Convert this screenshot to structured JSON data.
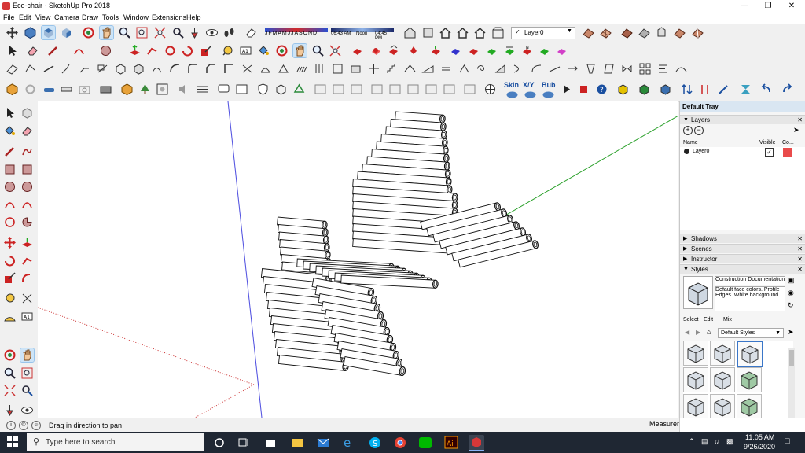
{
  "window": {
    "title": "Eco-chair - SketchUp Pro 2018"
  },
  "menu": [
    "File",
    "Edit",
    "View",
    "Camera",
    "Draw",
    "Tools",
    "Window",
    "Extensions",
    "Help"
  ],
  "shadow_settings": {
    "months": [
      "J",
      "F",
      "M",
      "A",
      "M",
      "J",
      "J",
      "A",
      "S",
      "O",
      "N",
      "D"
    ],
    "start_time": "06:43 AM",
    "noon": "Noon",
    "end_time": "04:45 PM"
  },
  "layer_toolbar": {
    "current_layer": "Layer0"
  },
  "plugin_toolbar": {
    "skin": "Skin",
    "xyz": "X/Y",
    "bub": "Bub"
  },
  "status": {
    "hint": "Drag in direction to pan",
    "measurements": "Measurements"
  },
  "tray": {
    "title": "Default Tray",
    "layers": {
      "section": "Layers",
      "columns": {
        "name": "Name",
        "visible": "Visible",
        "color": "Co..."
      },
      "rows": [
        {
          "name": "Layer0",
          "visible": true,
          "color": "#e94b4b"
        }
      ]
    },
    "sections": [
      "Shadows",
      "Scenes",
      "Instructor"
    ],
    "styles": {
      "section": "Styles",
      "name": "Construction Documentation",
      "description": "Default face colors. Profile Edges. White background.",
      "tabs": [
        "Select",
        "Edit",
        "Mix"
      ],
      "collection": "Default Styles"
    }
  },
  "taskbar": {
    "search_placeholder": "Type here to search",
    "time": "11:05 AM",
    "date": "9/26/2020"
  },
  "colors": {
    "selection_blue": "#cde4f7",
    "layer_red": "#e94b4b",
    "taskbar": "#1f2733"
  }
}
